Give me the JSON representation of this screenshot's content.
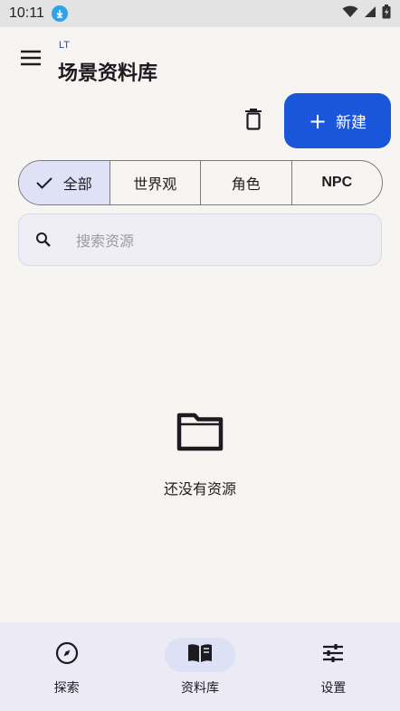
{
  "status_bar": {
    "time": "10:11"
  },
  "header": {
    "subtitle": "LT",
    "title": "场景资料库"
  },
  "actions": {
    "new_label": "新建",
    "new_plus": "+"
  },
  "filters": {
    "items": [
      "全部",
      "世界观",
      "角色",
      "NPC"
    ],
    "selected": "全部"
  },
  "search": {
    "placeholder": "搜索资源"
  },
  "empty": {
    "message": "还没有资源"
  },
  "bottom_nav": {
    "items": [
      {
        "label": "探索",
        "icon": "compass-icon"
      },
      {
        "label": "资料库",
        "icon": "book-icon"
      },
      {
        "label": "设置",
        "icon": "sliders-icon"
      }
    ],
    "active": "资料库"
  },
  "colors": {
    "accent": "#1a56db",
    "selected_chip": "#dfe1f7",
    "background": "#f7f5f2"
  }
}
